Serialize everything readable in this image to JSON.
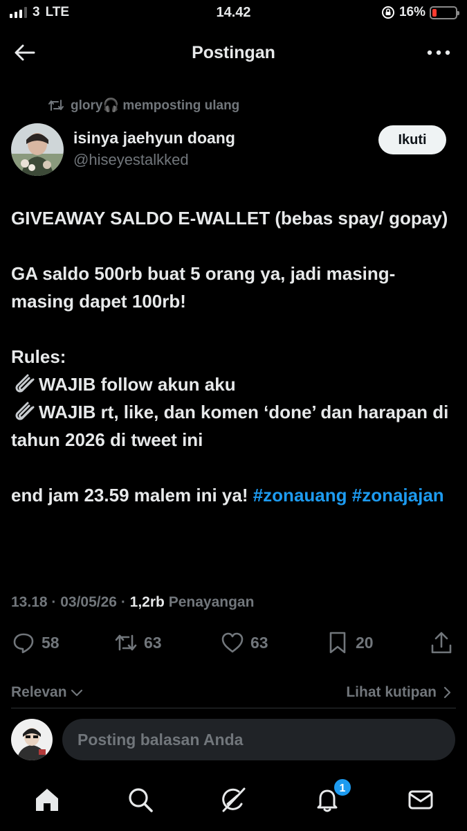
{
  "status_bar": {
    "carrier": "3",
    "network": "LTE",
    "time": "14.42",
    "battery": "16%",
    "battery_level": 0.16
  },
  "header": {
    "title": "Postingan"
  },
  "repost": {
    "text": "glory🎧 memposting ulang"
  },
  "author": {
    "name": "isinya jaehyun doang",
    "handle": "@hiseyestalkked",
    "follow_label": "Ikuti"
  },
  "post": {
    "line1": "GIVEAWAY SALDO E-WALLET (bebas spay/ gopay)",
    "line2": "GA saldo 500rb buat 5 orang ya, jadi masing-masing dapet 100rb!",
    "rules_title": "Rules:",
    "rule1": "WAJIB follow akun aku",
    "rule2": "WAJIB rt, like, dan komen ‘done’ dan harapan di tahun 2026 di tweet ini",
    "end_text": "end jam 23.59 malem ini ya! ",
    "hashtag1": "#zonauang",
    "hashtag2": "#zonajajan"
  },
  "meta": {
    "time": "13.18",
    "date": "03/05/26",
    "views_count": "1,2rb",
    "views_label": "Penayangan"
  },
  "actions": {
    "replies": "58",
    "reposts": "63",
    "likes": "63",
    "bookmarks": "20"
  },
  "sort": {
    "label": "Relevan",
    "quotes_label": "Lihat kutipan"
  },
  "reply": {
    "placeholder": "Posting balasan Anda"
  },
  "nav": {
    "notifications_badge": "1"
  },
  "icons": [
    "back-arrow-icon",
    "more-icon",
    "repost-icon",
    "headphones-icon",
    "paperclip-icon",
    "reply-icon",
    "like-icon",
    "bookmark-icon",
    "share-icon",
    "chevron-down-icon",
    "chevron-right-icon",
    "home-icon",
    "search-icon",
    "grok-icon",
    "bell-icon",
    "mail-icon"
  ],
  "colors": {
    "accent": "#1d9bf0",
    "muted": "#71767b",
    "text": "#e7e9ea",
    "background": "#000000"
  }
}
